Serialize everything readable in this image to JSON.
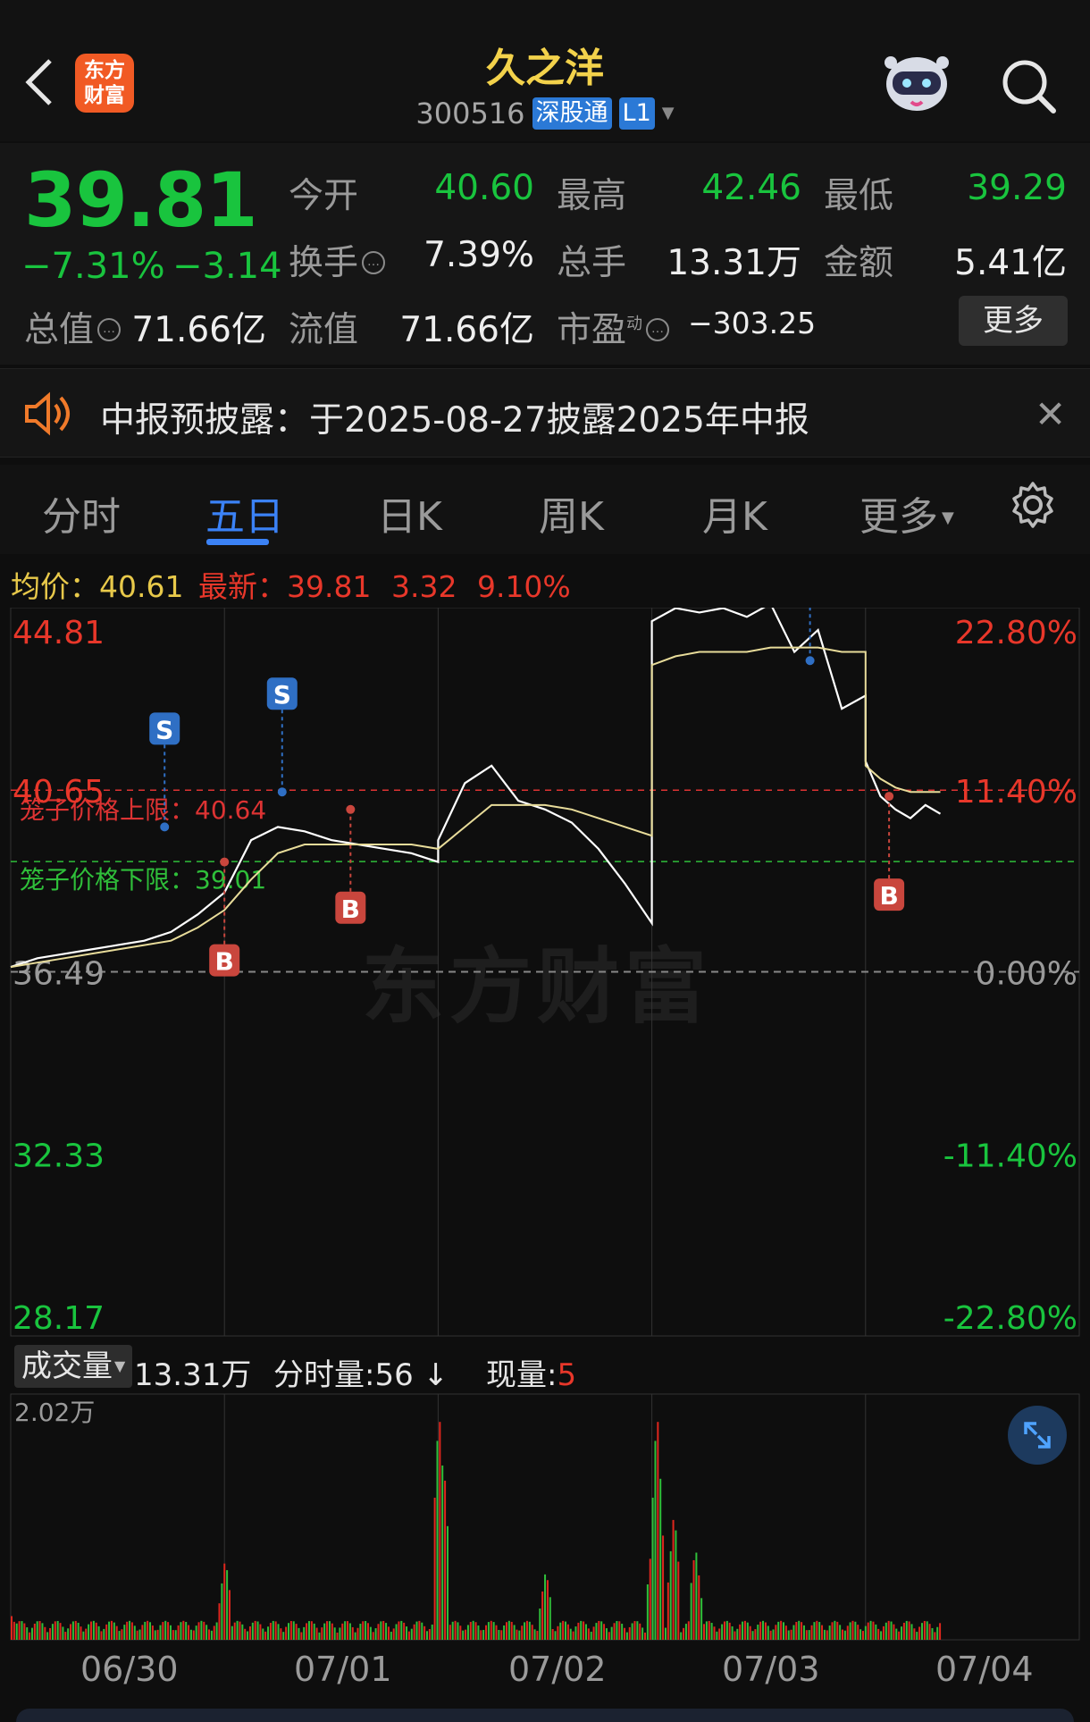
{
  "header": {
    "logo_text": "东方\n财富",
    "title": "久之洋",
    "code": "300516",
    "tag_market": "深股通",
    "tag_level": "L1"
  },
  "quote": {
    "price": "39.81",
    "change_pct": "−7.31%",
    "change_abs": "−3.14",
    "open_label": "今开",
    "open": "40.60",
    "high_label": "最高",
    "high": "42.46",
    "low_label": "最低",
    "low": "39.29",
    "turnover_label": "换手",
    "turnover": "7.39%",
    "volume_label": "总手",
    "volume": "13.31万",
    "amount_label": "金额",
    "amount": "5.41亿",
    "mcap_label": "总值",
    "mcap": "71.66亿",
    "float_label": "流值",
    "float": "71.66亿",
    "pe_label": "市盈",
    "pe_sup": "动",
    "pe": "−303.25",
    "more": "更多"
  },
  "notice": {
    "text": "中报预披露：于2025-08-27披露2025年中报"
  },
  "tabs": [
    {
      "label": "分时"
    },
    {
      "label": "五日"
    },
    {
      "label": "日K"
    },
    {
      "label": "周K"
    },
    {
      "label": "月K"
    },
    {
      "label": "更多"
    }
  ],
  "infoline": {
    "avg_label": "均价：",
    "avg": "40.61",
    "latest_label": "最新：",
    "latest": "39.81",
    "latest_chg": "3.32",
    "latest_pct": "9.10%"
  },
  "chart_data": {
    "type": "line",
    "title": "",
    "y_left_ticks": [
      "44.81",
      "40.65",
      "36.49",
      "32.33",
      "28.17"
    ],
    "y_right_ticks": [
      "22.80%",
      "11.40%",
      "0.00%",
      "-11.40%",
      "-22.80%"
    ],
    "ylim": [
      28.17,
      44.81
    ],
    "base_price": 36.49,
    "x_labels": [
      "06/30",
      "07/01",
      "07/02",
      "07/03",
      "07/04"
    ],
    "cage_upper_label": "笼子价格上限：40.64",
    "cage_lower_label": "笼子价格下限：39.01",
    "cage_upper": 40.64,
    "cage_lower": 39.01,
    "watermark": "东方财富",
    "series": [
      {
        "name": "price",
        "color": "#ffffff",
        "values": [
          36.6,
          36.8,
          36.9,
          37.0,
          37.1,
          37.2,
          37.4,
          37.8,
          38.3,
          39.5,
          39.8,
          39.7,
          39.5,
          39.4,
          39.3,
          39.2,
          39.0,
          39.5,
          40.8,
          41.2,
          40.4,
          40.2,
          39.9,
          39.3,
          38.5,
          37.6,
          44.5,
          44.8,
          44.7,
          44.8,
          44.6,
          44.9,
          43.8,
          44.3,
          42.5,
          42.8,
          41.3,
          40.5,
          40.2,
          40.0,
          40.3,
          40.1
        ]
      },
      {
        "name": "avg",
        "color": "#e8dc9a",
        "values": [
          36.6,
          36.7,
          36.8,
          36.9,
          37.0,
          37.1,
          37.2,
          37.5,
          37.9,
          38.6,
          39.2,
          39.4,
          39.4,
          39.4,
          39.4,
          39.4,
          39.3,
          39.3,
          39.8,
          40.3,
          40.3,
          40.3,
          40.2,
          40.0,
          39.8,
          39.6,
          43.5,
          43.7,
          43.8,
          43.8,
          43.8,
          43.9,
          43.9,
          43.9,
          43.8,
          43.8,
          41.2,
          40.9,
          40.7,
          40.6,
          40.6,
          40.6
        ]
      }
    ],
    "markers": [
      {
        "type": "S",
        "day": 0.72,
        "price": 39.8
      },
      {
        "type": "B",
        "day": 1.0,
        "price": 39.0
      },
      {
        "type": "S",
        "day": 1.27,
        "price": 40.6
      },
      {
        "type": "B",
        "day": 1.59,
        "price": 40.2
      },
      {
        "type": "S",
        "day": 3.74,
        "price": 43.6
      },
      {
        "type": "B",
        "day": 4.11,
        "price": 40.5
      }
    ],
    "volume": {
      "max_label": "2.02万",
      "total_label": "成交量",
      "total": "13.31万",
      "minute_label": "分时量:56",
      "current_label": "现量:",
      "current": "5"
    }
  }
}
